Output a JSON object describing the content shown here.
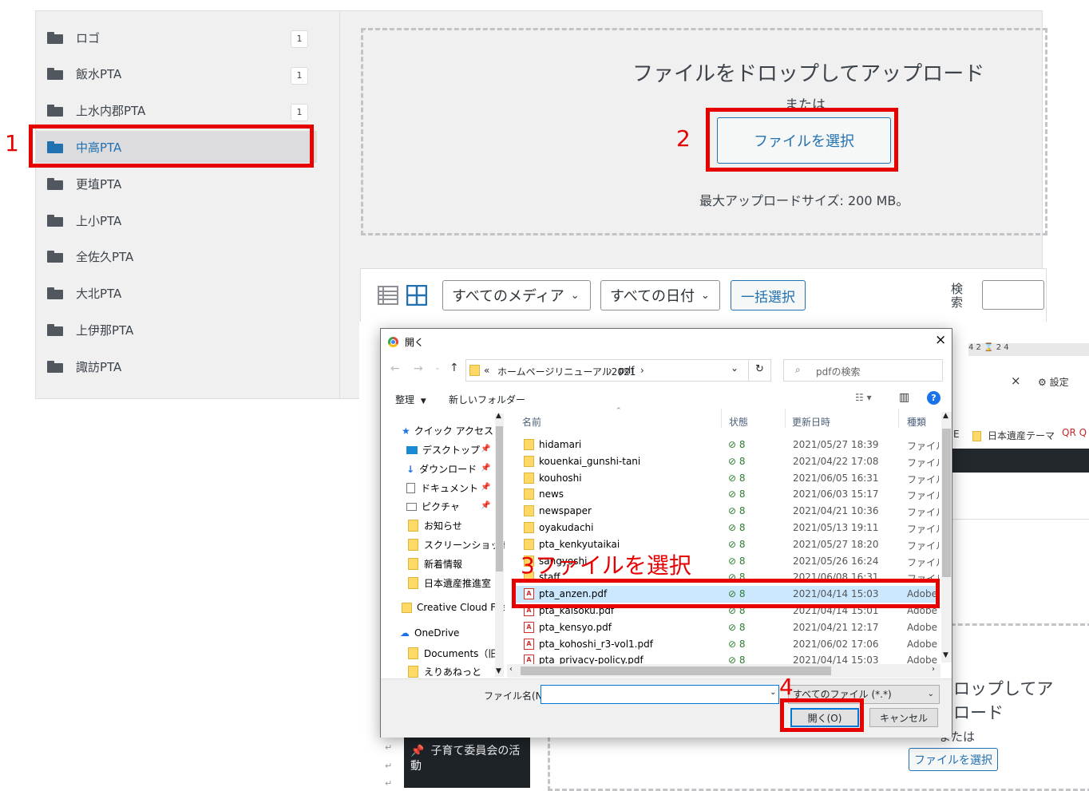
{
  "wp": {
    "folders": [
      {
        "label": "ロゴ",
        "count": "1"
      },
      {
        "label": "飯水PTA",
        "count": "1"
      },
      {
        "label": "上水内郡PTA",
        "count": "1"
      },
      {
        "label": "中高PTA",
        "count": ""
      },
      {
        "label": "更埴PTA",
        "count": ""
      },
      {
        "label": "上小PTA",
        "count": ""
      },
      {
        "label": "全佐久PTA",
        "count": ""
      },
      {
        "label": "大北PTA",
        "count": ""
      },
      {
        "label": "上伊那PTA",
        "count": ""
      },
      {
        "label": "諏訪PTA",
        "count": ""
      }
    ],
    "upload": {
      "drop_text": "ファイルをドロップしてアップロード",
      "or_text": "または",
      "select_button": "ファイルを選択",
      "max_size": "最大アップロードサイズ: 200 MB。"
    },
    "toolbar": {
      "media_filter": "すべてのメディア",
      "date_filter": "すべての日付",
      "bulk_select": "一括選択",
      "search_label": "検索"
    }
  },
  "background_window": {
    "ruler": "4   2   ⌛   2   4",
    "close": "×",
    "settings": "⚙ 設定",
    "bookmark_1": "E",
    "bookmark_2": "日本遺産テーマ",
    "bookmark_3": "QR Q",
    "drop_text_1": "ロップしてア",
    "drop_text_2": "ロード",
    "or_text": "または",
    "select_button": "ファイルを選択",
    "sidebar_item": "子育て委員会の活動"
  },
  "dialog": {
    "title": "開く",
    "close": "×",
    "breadcrumb": [
      "«",
      "ホームページリニューアル2021",
      "pdf"
    ],
    "search_placeholder": "pdfの検索",
    "organize": "整理",
    "new_folder": "新しいフォルダー",
    "nav": [
      {
        "label": "クイック アクセス",
        "type": "star"
      },
      {
        "label": "デスクトップ",
        "type": "desktop",
        "pinned": true
      },
      {
        "label": "ダウンロード",
        "type": "download",
        "pinned": true
      },
      {
        "label": "ドキュメント",
        "type": "document",
        "pinned": true
      },
      {
        "label": "ピクチャ",
        "type": "picture",
        "pinned": true
      },
      {
        "label": "お知らせ",
        "type": "folder"
      },
      {
        "label": "スクリーンショット",
        "type": "folder"
      },
      {
        "label": "新着情報",
        "type": "folder"
      },
      {
        "label": "日本遺産推進室",
        "type": "folder"
      },
      {
        "label": "Creative Cloud File",
        "type": "cc"
      },
      {
        "label": "OneDrive",
        "type": "cloud"
      },
      {
        "label": "Documents（旧:",
        "type": "folder"
      },
      {
        "label": "えりあねっと",
        "type": "folder"
      }
    ],
    "columns": {
      "name": "名前",
      "status": "状態",
      "date": "更新日時",
      "type": "種類"
    },
    "files": [
      {
        "name": "hidamari",
        "kind": "folder",
        "status": "⊘ 8",
        "date": "2021/05/27 18:39",
        "type": "ファイル フ"
      },
      {
        "name": "kouenkai_gunshi-tani",
        "kind": "folder",
        "status": "⊘ 8",
        "date": "2021/04/22 17:08",
        "type": "ファイル フ"
      },
      {
        "name": "kouhoshi",
        "kind": "folder",
        "status": "⊘ 8",
        "date": "2021/06/05 16:31",
        "type": "ファイル フ"
      },
      {
        "name": "news",
        "kind": "folder",
        "status": "⊘ 8",
        "date": "2021/06/03 15:17",
        "type": "ファイル フ"
      },
      {
        "name": "newspaper",
        "kind": "folder",
        "status": "⊘ 8",
        "date": "2021/04/21 10:36",
        "type": "ファイル フ"
      },
      {
        "name": "oyakudachi",
        "kind": "folder",
        "status": "⊘ 8",
        "date": "2021/05/13 19:11",
        "type": "ファイル フ"
      },
      {
        "name": "pta_kenkyutaikai",
        "kind": "folder",
        "status": "⊘ 8",
        "date": "2021/05/27 18:20",
        "type": "ファイル フ"
      },
      {
        "name": "sangyoshi",
        "kind": "folder",
        "status": "⊘ 8",
        "date": "2021/05/26 16:24",
        "type": "ファイル フ"
      },
      {
        "name": "staff",
        "kind": "folder",
        "status": "⊘ 8",
        "date": "2021/06/08 16:31",
        "type": "ファイル フ"
      },
      {
        "name": "pta_anzen.pdf",
        "kind": "pdf",
        "status": "⊘ 8",
        "date": "2021/04/14 15:03",
        "type": "Adobe"
      },
      {
        "name": "pta_kaisoku.pdf",
        "kind": "pdf",
        "status": "⊘ 8",
        "date": "2021/04/14 15:01",
        "type": "Adobe /"
      },
      {
        "name": "pta_kensyo.pdf",
        "kind": "pdf",
        "status": "⊘ 8",
        "date": "2021/04/21 12:17",
        "type": "Adobe /"
      },
      {
        "name": "pta_kohoshi_r3-vol1.pdf",
        "kind": "pdf",
        "status": "⊘ 8",
        "date": "2021/06/02 17:06",
        "type": "Adobe /"
      },
      {
        "name": "pta_privacy-policy.pdf",
        "kind": "pdf",
        "status": "⊘ 8",
        "date": "2021/04/14 15:03",
        "type": "Adobe /"
      }
    ],
    "filename_label": "ファイル名(N):",
    "filename_value": "",
    "filetype": "すべてのファイル (*.*)",
    "open_button": "開く(O)",
    "cancel_button": "キャンセル"
  },
  "annotations": {
    "step1": "1",
    "step2": "2",
    "step3": "3ファイルを選択",
    "step4": "4",
    "color": "#e60000"
  }
}
